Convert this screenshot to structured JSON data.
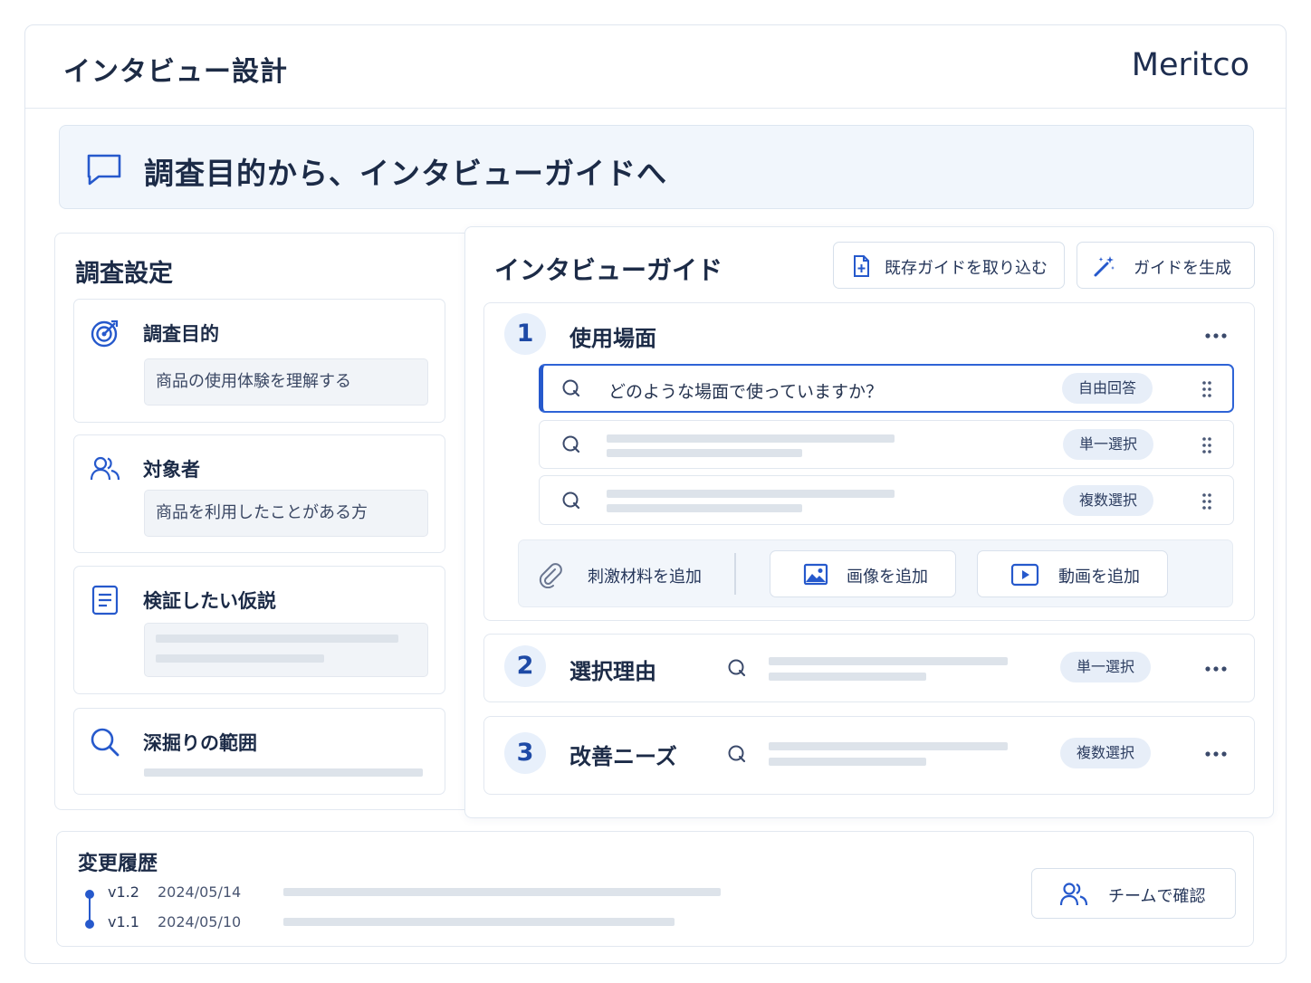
{
  "header": {
    "title": "インタビュー設計",
    "brand": "Meritco"
  },
  "hero": {
    "title": "調査目的から、インタビューガイドへ",
    "icon": "chat-bubble-icon"
  },
  "settings": {
    "heading": "調査設定",
    "purpose": {
      "label": "調査目的",
      "value": "商品の使用体験を理解する",
      "icon": "target-icon"
    },
    "audience": {
      "label": "対象者",
      "value": "商品を利用したことがある方",
      "icon": "users-icon"
    },
    "hypothesis": {
      "label": "検証したい仮説",
      "icon": "document-icon"
    },
    "scope": {
      "label": "深掘りの範囲",
      "icon": "search-icon"
    }
  },
  "guide": {
    "heading": "インタビューガイド",
    "import_label": "既存ガイドを取り込む",
    "generate_label": "ガイドを生成",
    "sections": [
      {
        "number": "1",
        "title": "使用場面",
        "questions": [
          {
            "text": "どのような場面で使っていますか？",
            "type": "自由回答"
          },
          {
            "text": "",
            "type": "単一選択"
          },
          {
            "text": "",
            "type": "複数選択"
          }
        ],
        "media": {
          "stimulus_label": "刺激材料を追加",
          "image_label": "画像を追加",
          "video_label": "動画を追加"
        }
      },
      {
        "number": "2",
        "title": "選択理由",
        "type": "単一選択"
      },
      {
        "number": "3",
        "title": "改善ニーズ",
        "type": "複数選択"
      }
    ]
  },
  "history": {
    "title": "変更履歴",
    "entries": [
      {
        "version": "v1.2",
        "date": "2024/05/14"
      },
      {
        "version": "v1.1",
        "date": "2024/05/10"
      }
    ],
    "team_label": "チームで確認"
  },
  "colors": {
    "accent": "#2659cc",
    "text": "#1c2b47",
    "pill_bg": "#e7eef8",
    "hero_bg": "#f1f6fc"
  }
}
